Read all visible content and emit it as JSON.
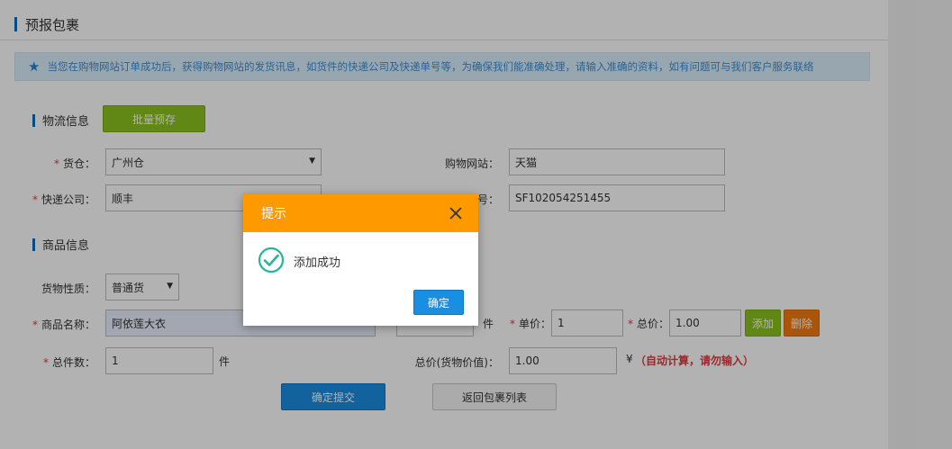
{
  "page": {
    "title": "预报包裹"
  },
  "notice": {
    "text": "当您在购物网站订单成功后，获得购物网站的发货讯息，如货件的快递公司及快递单号等，为确保我们能准确处理，请输入准确的资料，如有问题可与我们客户服务联络"
  },
  "logistics": {
    "section_title": "物流信息",
    "batch_button": "批量预存",
    "warehouse_label": "货仓：",
    "warehouse_value": "广州仓",
    "shop_label": "购物网站：",
    "shop_value": "天猫",
    "courier_label": "快递公司：",
    "courier_value": "顺丰",
    "tracking_label": "号：",
    "tracking_value": "SF102054251455"
  },
  "goods": {
    "section_title": "商品信息",
    "nature_label": "货物性质：",
    "nature_value": "普通货",
    "name_label": "商品名称：",
    "name_value": "阿依莲大衣",
    "qty_unit": "件",
    "price_label": "单价：",
    "price_value": "1",
    "total_label": "总价：",
    "total_value": "1.00",
    "add_button": "添加",
    "delete_button": "删除",
    "count_label": "总件数：",
    "count_value": "1",
    "count_unit": "件",
    "value_label": "总价(货物价值)：",
    "value_value": "1.00",
    "currency": "¥",
    "auto_note": "（自动计算，请勿输入）"
  },
  "actions": {
    "submit_button": "确定提交",
    "back_button": "返回包裹列表"
  },
  "dialog": {
    "title": "提示",
    "message": "添加成功",
    "ok_button": "确定"
  },
  "colors": {
    "dialog_header": "#fe9900",
    "primary_blue": "#1a8ee1",
    "success_green": "#26b59a",
    "add_green": "#8cc21f",
    "delete_orange": "#f47a0e"
  }
}
